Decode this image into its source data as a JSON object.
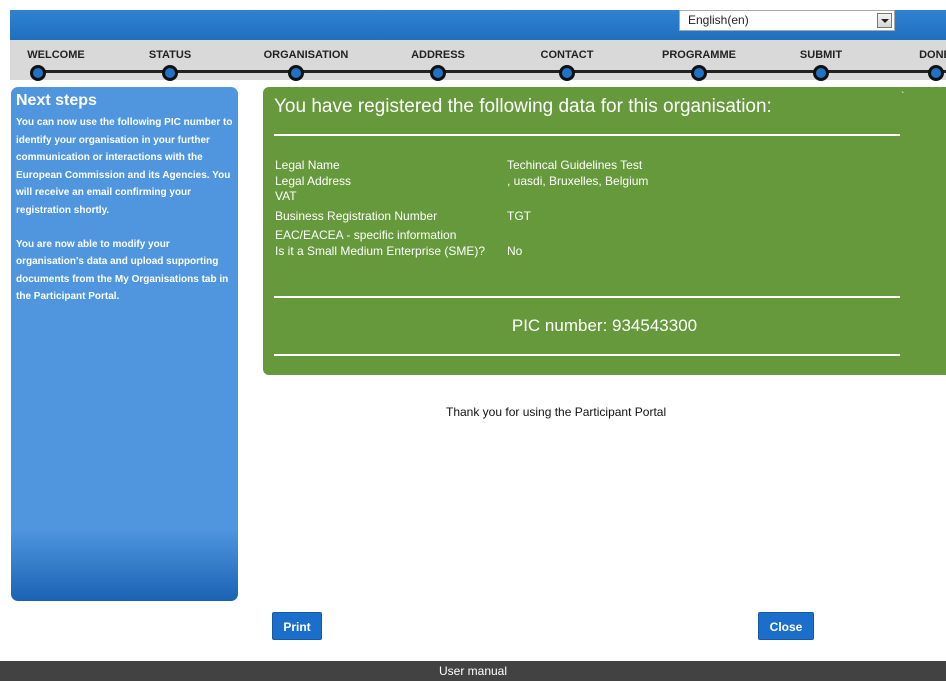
{
  "language": {
    "selected": "English(en)"
  },
  "steps": [
    "WELCOME",
    "STATUS",
    "ORGANISATION",
    "ADDRESS",
    "CONTACT",
    "PROGRAMME",
    "SUBMIT",
    "DONE"
  ],
  "next_steps": {
    "title": "Next steps",
    "para1": "You can now use the following PIC number to identify your organisation in your further communication or interactions with the European Commission and its Agencies. You will receive an email confirming your registration shortly.",
    "para2": "You are now able to modify your organisation's data and upload supporting documents from the My Organisations tab in the Participant Portal."
  },
  "summary": {
    "heading": "You have registered the following data for this organisation:",
    "tick": "`",
    "rows": [
      {
        "label": "Legal Name",
        "value": "Techincal Guidelines Test"
      },
      {
        "label": "Legal Address",
        "value": ", uasdi, Bruxelles, Belgium"
      },
      {
        "label": "VAT",
        "value": ""
      },
      {
        "label": "Business Registration Number",
        "value": "TGT"
      },
      {
        "label": "EAC/EACEA - specific information",
        "value": ""
      },
      {
        "label": "Is it a Small Medium Enterprise (SME)?",
        "value": "No"
      }
    ],
    "pic": "PIC number: 934543300"
  },
  "thanks": "Thank you for using the Participant Portal",
  "buttons": {
    "print": "Print",
    "close": "Close"
  },
  "footer": {
    "user_manual": "User manual"
  }
}
